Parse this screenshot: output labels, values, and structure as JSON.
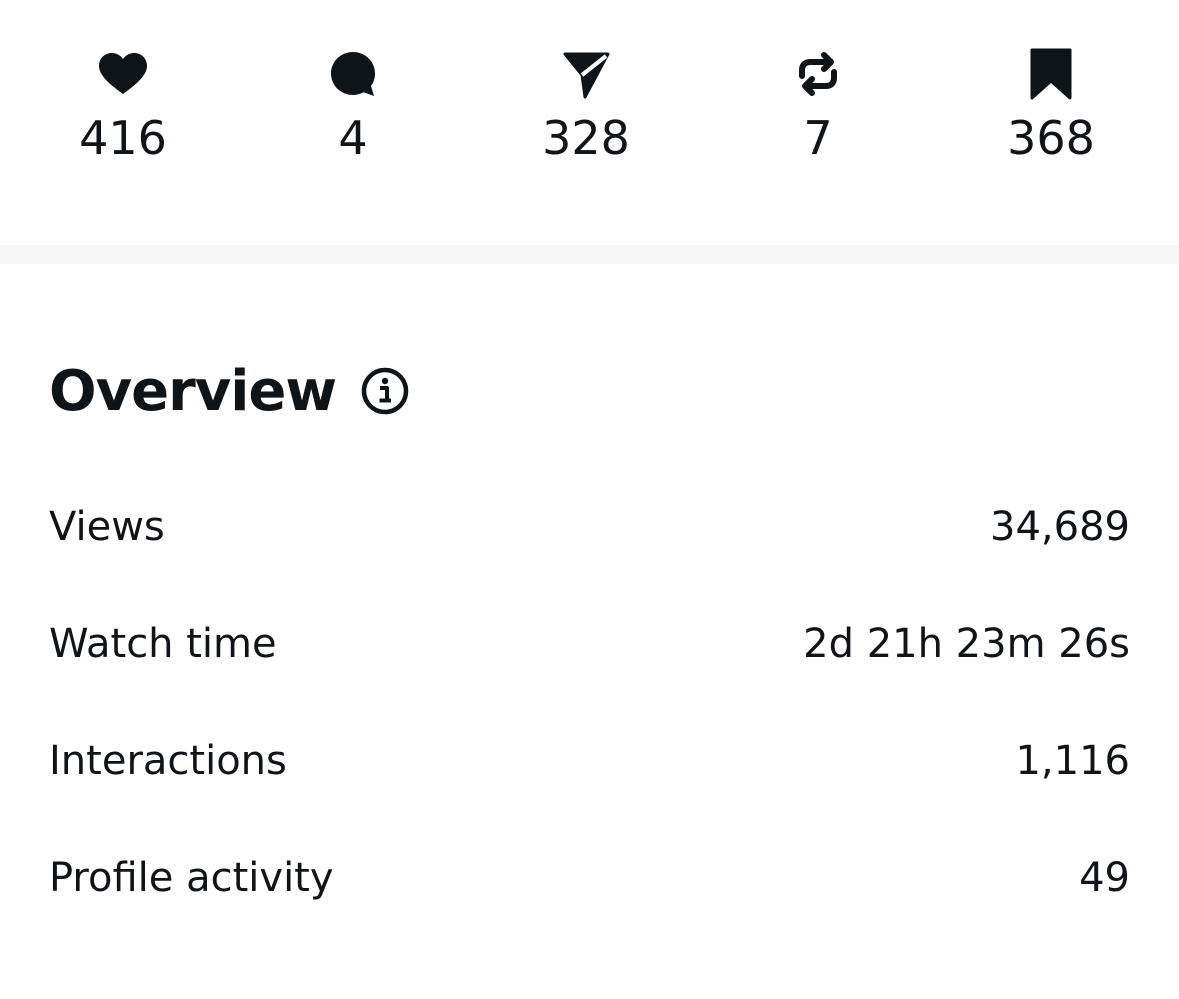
{
  "engagement": [
    {
      "icon": "heart-icon",
      "count": "416"
    },
    {
      "icon": "comment-icon",
      "count": "4"
    },
    {
      "icon": "share-icon",
      "count": "328"
    },
    {
      "icon": "repost-icon",
      "count": "7"
    },
    {
      "icon": "bookmark-icon",
      "count": "368"
    }
  ],
  "overview": {
    "title": "Overview",
    "info_icon": "info-icon",
    "metrics": [
      {
        "label": "Views",
        "value": "34,689"
      },
      {
        "label": "Watch time",
        "value": "2d 21h 23m 26s"
      },
      {
        "label": "Interactions",
        "value": "1,116"
      },
      {
        "label": "Profile activity",
        "value": "49"
      }
    ]
  },
  "colors": {
    "text": "#0f1419",
    "divider": "#f6f6f6",
    "background": "#ffffff"
  }
}
